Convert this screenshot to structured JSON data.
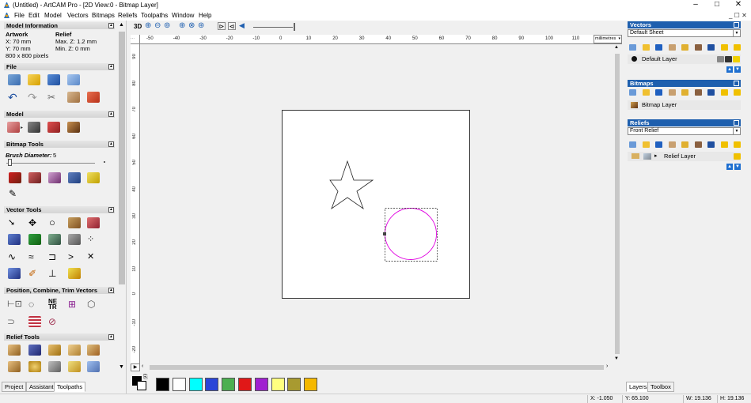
{
  "window": {
    "title": "(Untitled) - ArtCAM Pro - [2D View:0 - Bitmap Layer]",
    "minimize": "–",
    "maximize": "□",
    "close": "✕",
    "mdi_controls": "_ ☐ ✕"
  },
  "menu": [
    "File",
    "Edit",
    "Model",
    "Vectors",
    "Bitmaps",
    "Reliefs",
    "Toolpaths",
    "Window",
    "Help"
  ],
  "left_panel": {
    "model_info": {
      "heading": "Model Information",
      "artwork_label": "Artwork",
      "relief_label": "Relief",
      "x": "X: 70 mm",
      "y": "Y: 70 mm",
      "pixels": "800 x 800 pixels",
      "max_z": "Max. Z: 1.2 mm",
      "min_z": "Min. Z: 0 mm"
    },
    "sections": {
      "file": "File",
      "model": "Model",
      "bitmap_tools": "Bitmap Tools",
      "vector_tools": "Vector Tools",
      "position": "Position, Combine, Trim Vectors",
      "relief_tools": "Relief Tools"
    },
    "brush_label": "Brush Diameter:",
    "brush_value": "5",
    "tabs": [
      "Project",
      "Assistant",
      "Toolpaths"
    ],
    "active_tab": "Toolpaths"
  },
  "view_toolbar": {
    "mode_3d": "3D"
  },
  "ruler": {
    "units": "millimetres",
    "top_labels": [
      "-50",
      "-40",
      "-30",
      "-20",
      "-10",
      "0",
      "10",
      "20",
      "30",
      "40",
      "50",
      "60",
      "70",
      "80",
      "90",
      "100",
      "110"
    ],
    "left_labels": [
      "90",
      "80",
      "70",
      "60",
      "50",
      "40",
      "30",
      "20",
      "10",
      "0",
      "-10",
      "-20"
    ]
  },
  "color_swatches": [
    "#000000",
    "#ffffff",
    "#00ffff",
    "#2a45d8",
    "#4caf50",
    "#e01818",
    "#a020d0",
    "#ffff80",
    "#a89a30",
    "#f5b800"
  ],
  "right_panel": {
    "vectors_heading": "Vectors",
    "vectors_sheet": "Default Sheet",
    "default_layer": "Default Layer",
    "bitmaps_heading": "Bitmaps",
    "bitmap_layer": "Bitmap Layer",
    "reliefs_heading": "Reliefs",
    "reliefs_sheet": "Front Relief",
    "relief_layer": "Relief Layer",
    "tabs": [
      "Layers",
      "Toolbox"
    ],
    "active_tab": "Layers"
  },
  "status": {
    "x": "X: -1.050",
    "y": "Y: 65.100",
    "w": "W: 19.136",
    "h": "H: 19.136"
  }
}
